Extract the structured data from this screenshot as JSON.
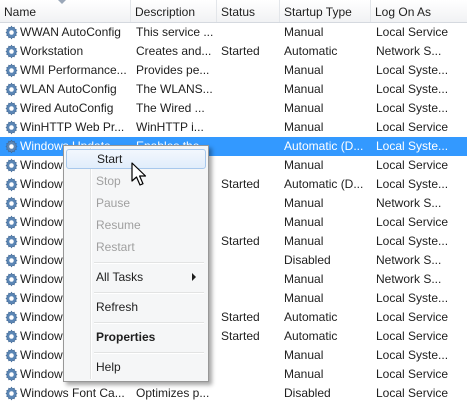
{
  "columns": {
    "name": "Name",
    "description": "Description",
    "status": "Status",
    "startup_type": "Startup Type",
    "log_on_as": "Log On As"
  },
  "rows": [
    {
      "name": "WWAN AutoConfig",
      "description": "This service ...",
      "status": "",
      "startup_type": "Manual",
      "log_on_as": "Local Service"
    },
    {
      "name": "Workstation",
      "description": "Creates and...",
      "status": "Started",
      "startup_type": "Automatic",
      "log_on_as": "Network S..."
    },
    {
      "name": "WMI Performance...",
      "description": "Provides pe...",
      "status": "",
      "startup_type": "Manual",
      "log_on_as": "Local Syste..."
    },
    {
      "name": "WLAN AutoConfig",
      "description": "The WLANS...",
      "status": "",
      "startup_type": "Manual",
      "log_on_as": "Local Syste..."
    },
    {
      "name": "Wired AutoConfig",
      "description": "The Wired ...",
      "status": "",
      "startup_type": "Manual",
      "log_on_as": "Local Syste..."
    },
    {
      "name": "WinHTTP Web Pr...",
      "description": "WinHTTP i...",
      "status": "",
      "startup_type": "Manual",
      "log_on_as": "Local Service"
    },
    {
      "name": "Windows Update",
      "description": "Enables the...",
      "status": "",
      "startup_type": "Automatic (D...",
      "log_on_as": "Local Syste...",
      "selected": true
    },
    {
      "name": "Windows Time",
      "description": "",
      "status": "",
      "startup_type": "Manual",
      "log_on_as": "Local Service"
    },
    {
      "name": "Windows Search",
      "description": "",
      "status": "Started",
      "startup_type": "Automatic (D...",
      "log_on_as": "Local Syste..."
    },
    {
      "name": "Windows Remote...",
      "description": "",
      "status": "",
      "startup_type": "Manual",
      "log_on_as": "Network S..."
    },
    {
      "name": "Windows Presen...",
      "description": "",
      "status": "",
      "startup_type": "Manual",
      "log_on_as": "Local Service"
    },
    {
      "name": "Windows Module...",
      "description": "",
      "status": "Started",
      "startup_type": "Manual",
      "log_on_as": "Local Syste..."
    },
    {
      "name": "Windows Media P...",
      "description": "",
      "status": "",
      "startup_type": "Disabled",
      "log_on_as": "Network S..."
    },
    {
      "name": "Windows Manage...",
      "description": "",
      "status": "",
      "startup_type": "Manual",
      "log_on_as": "Network S..."
    },
    {
      "name": "Windows Installer",
      "description": "",
      "status": "",
      "startup_type": "Manual",
      "log_on_as": "Local Syste..."
    },
    {
      "name": "Windows Image A...",
      "description": "",
      "status": "Started",
      "startup_type": "Automatic",
      "log_on_as": "Local Service"
    },
    {
      "name": "Windows Firewall",
      "description": "",
      "status": "Started",
      "startup_type": "Automatic",
      "log_on_as": "Local Service"
    },
    {
      "name": "Windows Font Ca...",
      "description": "",
      "status": "",
      "startup_type": "Manual",
      "log_on_as": "Local Syste..."
    },
    {
      "name": "Windows Error R...",
      "description": "",
      "status": "",
      "startup_type": "Manual",
      "log_on_as": "Local Service"
    },
    {
      "name": "Windows Font Ca...",
      "description": "Optimizes p...",
      "status": "",
      "startup_type": "Disabled",
      "log_on_as": "Local Service"
    }
  ],
  "context_menu": {
    "start": "Start",
    "stop": "Stop",
    "pause": "Pause",
    "resume": "Resume",
    "restart": "Restart",
    "all_tasks": "All Tasks",
    "refresh": "Refresh",
    "properties": "Properties",
    "help": "Help"
  },
  "colors": {
    "selection": "#3399ff",
    "menu_hover": "#e1edfb",
    "gear": "#5b86b5"
  },
  "icons": {
    "service": "gear-icon",
    "cursor": "mouse-pointer-icon",
    "submenu": "chevron-right-icon"
  }
}
